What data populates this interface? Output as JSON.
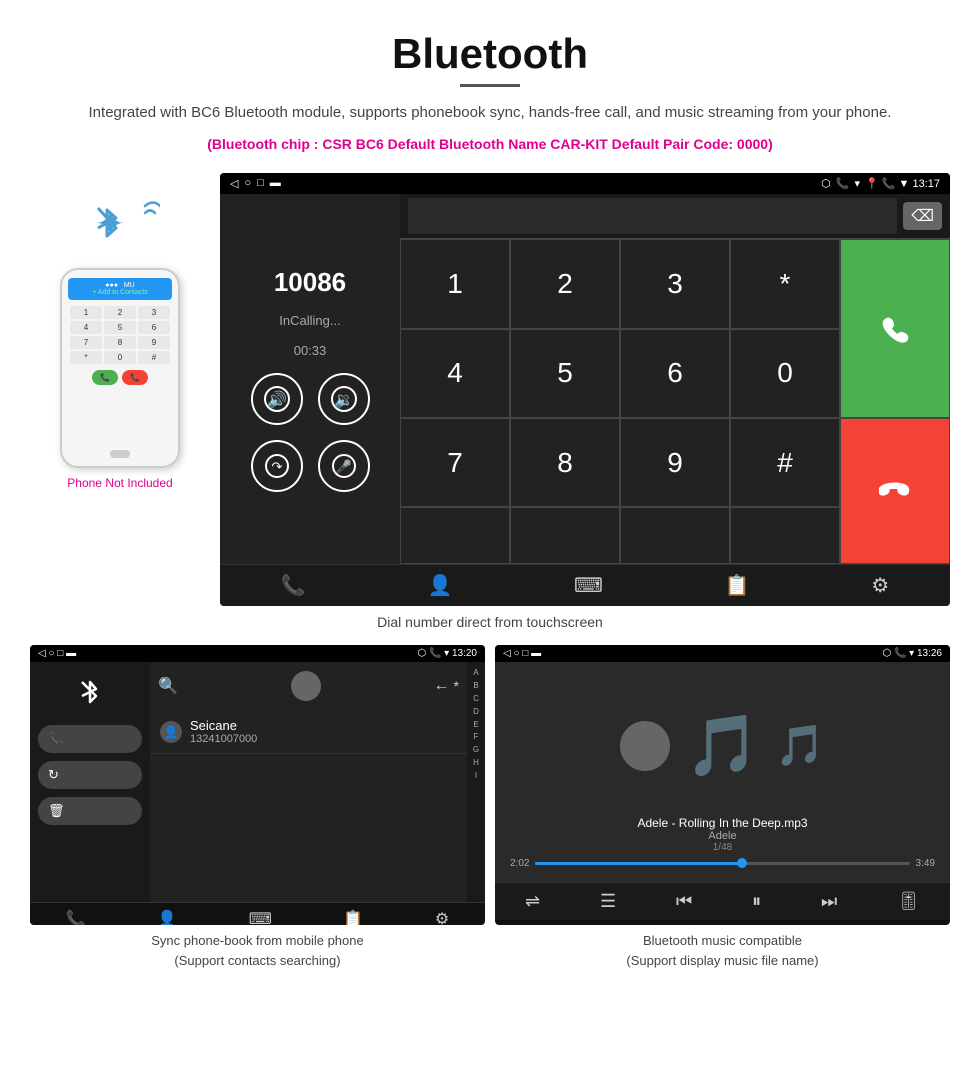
{
  "header": {
    "title": "Bluetooth",
    "description": "Integrated with BC6 Bluetooth module, supports phonebook sync, hands-free call, and music streaming from your phone.",
    "specs": "(Bluetooth chip : CSR BC6    Default Bluetooth Name CAR-KIT    Default Pair Code: 0000)"
  },
  "phone_section": {
    "not_included": "Phone Not Included"
  },
  "car_screen_main": {
    "status_left": "◁  ○  □  ⬛",
    "status_right": "📍  📞  ▼  13:17",
    "dialer_number": "10086",
    "incalling": "InCalling...",
    "timer": "00:33",
    "keys": [
      "1",
      "2",
      "3",
      "*",
      "4",
      "5",
      "6",
      "0",
      "7",
      "8",
      "9",
      "#"
    ]
  },
  "caption_main": "Dial number direct from touchscreen",
  "phonebook_screen": {
    "status_left": "◁  ○  □  ⬛",
    "status_right": "📍  📞  ▼  13:20",
    "contact_name": "Seicane",
    "contact_number": "13241007000",
    "alpha_letters": [
      "A",
      "B",
      "C",
      "D",
      "E",
      "F",
      "G",
      "H",
      "I"
    ]
  },
  "music_screen": {
    "status_left": "◁  ○  □  ⬛",
    "status_right": "📍  📞  ▼  13:26",
    "track_name": "Adele - Rolling In the Deep.mp3",
    "artist": "Adele",
    "track_num": "1/48",
    "time_current": "2:02",
    "time_total": "3:49"
  },
  "bottom_captions": {
    "phonebook": "Sync phone-book from mobile phone\n(Support contacts searching)",
    "phonebook_line1": "Sync phone-book from mobile phone",
    "phonebook_line2": "(Support contacts searching)",
    "music_line1": "Bluetooth music compatible",
    "music_line2": "(Support display music file name)"
  }
}
